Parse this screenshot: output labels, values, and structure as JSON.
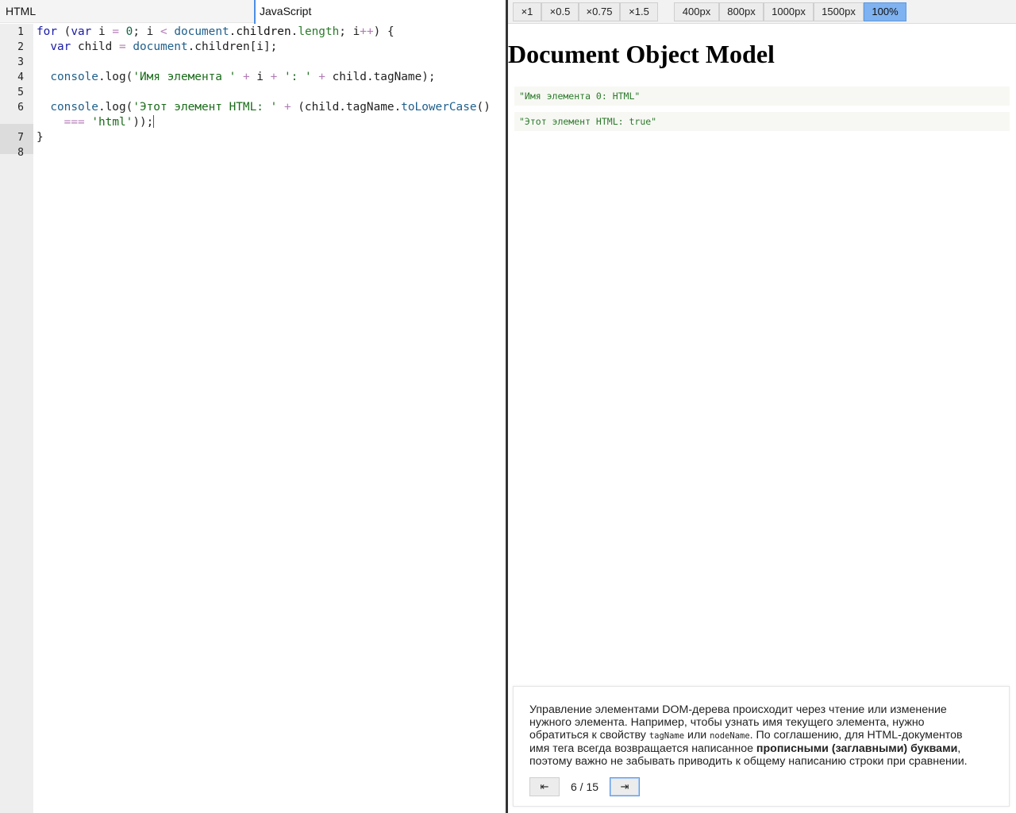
{
  "tabs": [
    {
      "label": "HTML",
      "active": false
    },
    {
      "label": "JavaScript",
      "active": true
    }
  ],
  "editor": {
    "line_numbers": [
      "1",
      "2",
      "3",
      "4",
      "5",
      "6",
      "7",
      "8"
    ],
    "active_line": "6"
  },
  "toolbar": {
    "speed": [
      "×1",
      "×0.5",
      "×0.75",
      "×1.5"
    ],
    "widths": [
      "400px",
      "800px",
      "1000px",
      "1500px",
      "100%"
    ],
    "active_width": "100%"
  },
  "preview": {
    "heading": "Document Object Model",
    "logs": [
      "\"Имя элемента 0: HTML\"",
      "\"Этот элемент HTML: true\""
    ]
  },
  "lesson": {
    "text_1": "Управление элементами DOM-дерева происходит через чтение или изменение нужного элемента. Например, чтобы узнать имя текущего элемента, нужно обратиться к свойству ",
    "code_1": "tagName",
    "text_2": " или ",
    "code_2": "nodeName",
    "text_3": ". По соглашению, для HTML-документов имя тега всегда возвращается написанное ",
    "bold": "прописными (заглавными) буквами",
    "text_4": ", поэтому важно не забывать приводить к общему написанию строки при сравнении.",
    "prev_label": "⇤",
    "next_label": "⇥",
    "page": "6 / 15"
  },
  "colors": {
    "accent": "#4a90e2",
    "active_button": "#7fb2f0",
    "keyword": "#1a1aa6",
    "string": "#1a6b1a"
  }
}
